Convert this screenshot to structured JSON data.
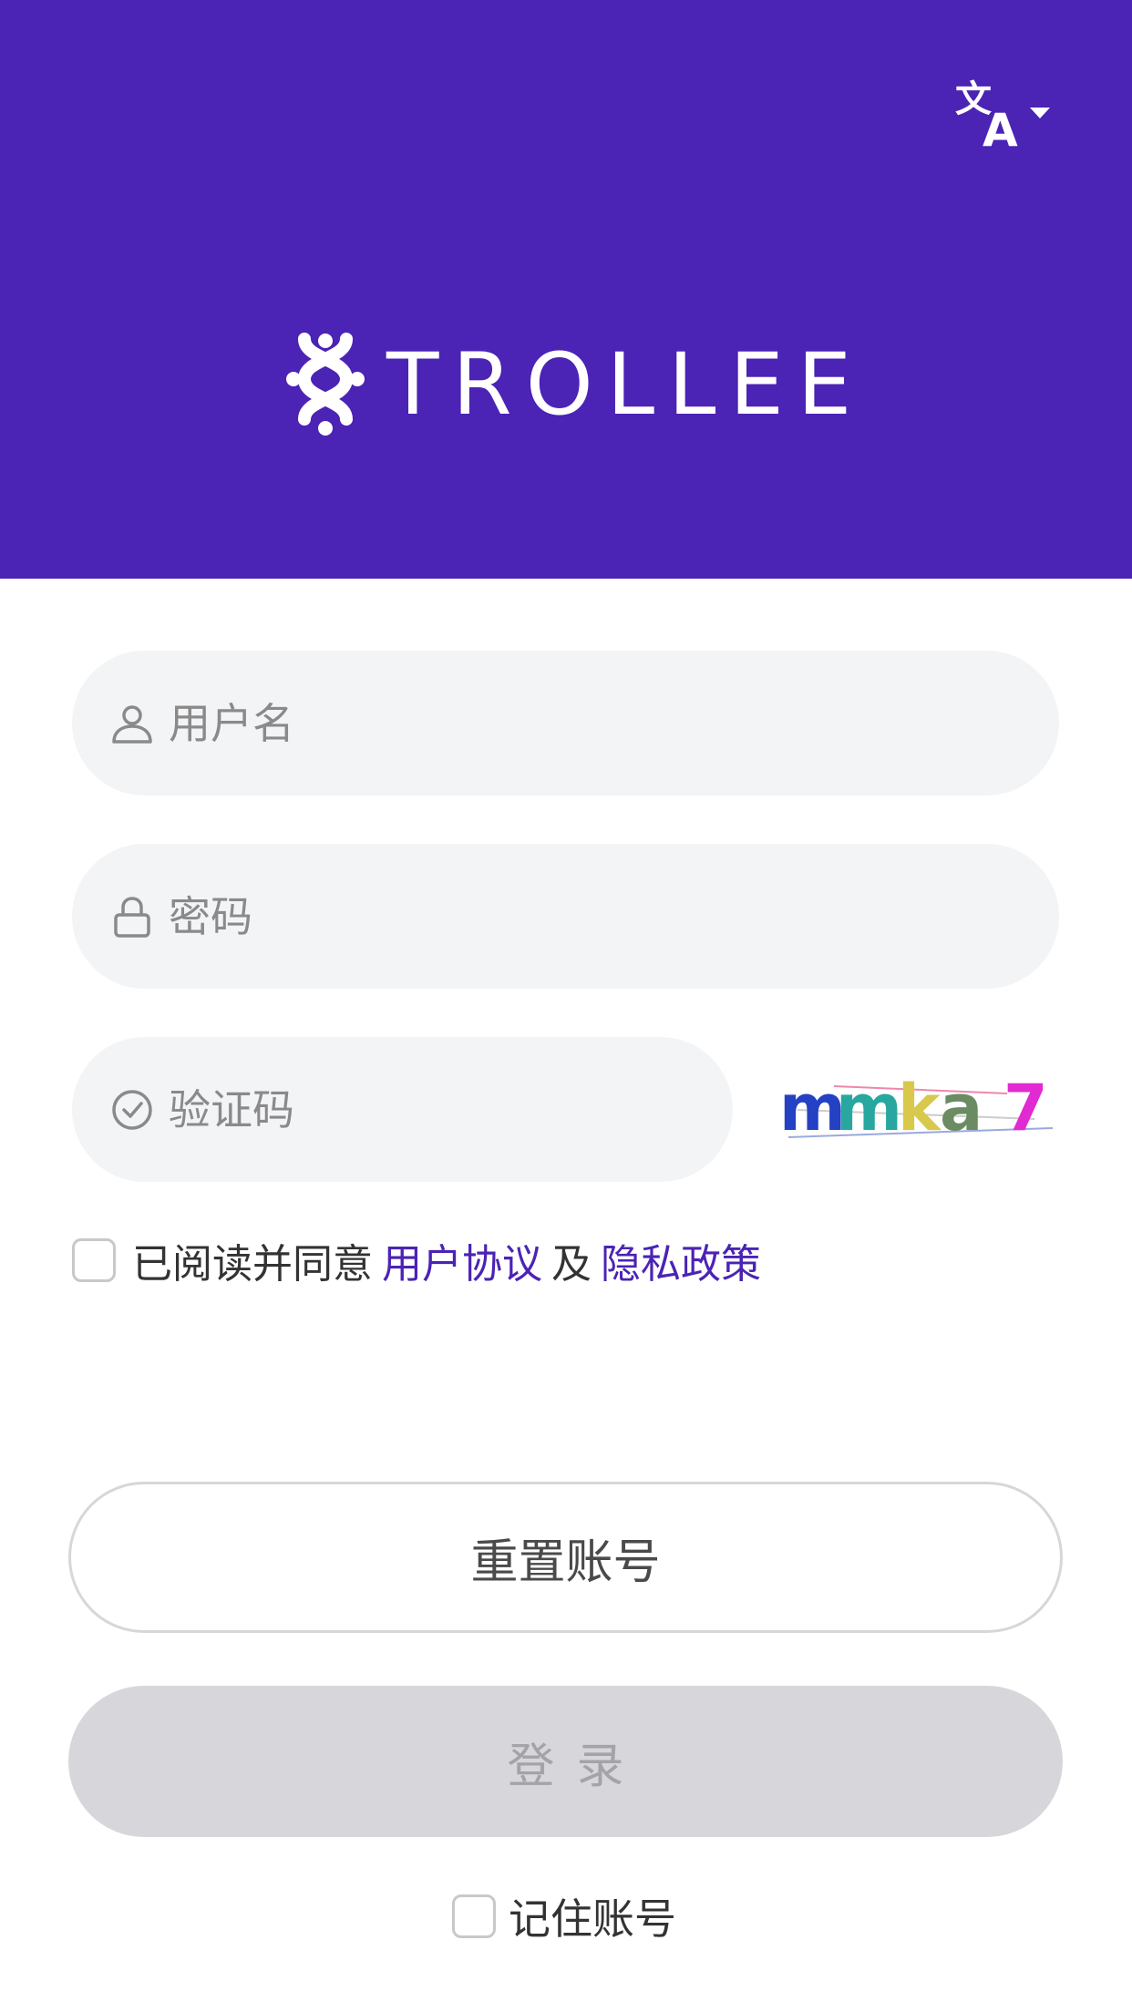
{
  "header": {
    "brand": "TROLLEE",
    "language_icon": "translate-icon",
    "dropdown_icon": "caret-down-icon",
    "background_color": "#4b23b5"
  },
  "form": {
    "username_placeholder": "用户名",
    "password_placeholder": "密码",
    "captcha_placeholder": "验证码",
    "captcha_text": "mmka7",
    "username_icon": "user-icon",
    "password_icon": "lock-icon",
    "captcha_icon": "check-circle-icon"
  },
  "agreement": {
    "prefix": "已阅读并同意",
    "user_agreement": "用户协议",
    "and": "及",
    "privacy_policy": "隐私政策",
    "link_color": "#4b23b5"
  },
  "buttons": {
    "reset": "重置账号",
    "login": "登录"
  },
  "remember": {
    "label": "记住账号"
  }
}
